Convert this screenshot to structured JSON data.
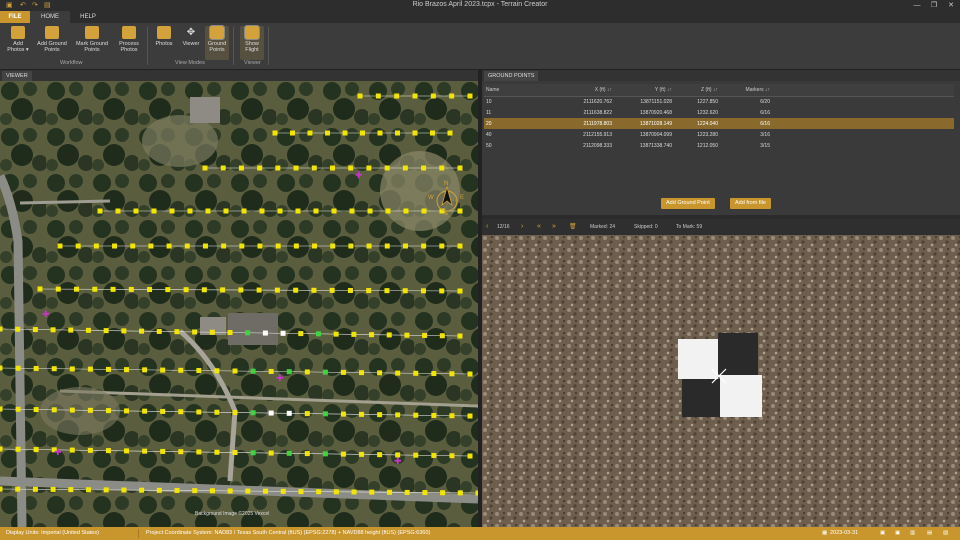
{
  "window": {
    "title": "Rio Brazos April 2023.tcpx  -  Terrain Creator",
    "controls": [
      "—",
      "❐",
      "✕"
    ]
  },
  "tabs": [
    "FILE",
    "HOME",
    "HELP"
  ],
  "ribbon": {
    "buttons": [
      {
        "label": "Add Photos ▾",
        "icon": "add-photos-icon"
      },
      {
        "label": "Add Ground Points",
        "icon": "add-ground-points-icon"
      },
      {
        "label": "Mark Ground Points",
        "icon": "mark-ground-points-icon"
      },
      {
        "label": "Process Photos",
        "icon": "process-photos-icon"
      },
      {
        "label": "Photos",
        "icon": "photos-icon"
      },
      {
        "label": "Viewer",
        "icon": "viewer-icon"
      },
      {
        "label": "Ground Points",
        "icon": "ground-points-icon"
      },
      {
        "label": "Show Flight",
        "icon": "show-flight-icon"
      }
    ],
    "groups": [
      "Workflow",
      "View Modes",
      "Viewer"
    ]
  },
  "viewer": {
    "tab": "VIEWER",
    "attribution": "Background Image ©2025 Vexcel",
    "compass": {
      "n": "N",
      "s": "S",
      "e": "E",
      "w": "W"
    }
  },
  "ground_points": {
    "tab": "GROUND POINTS",
    "columns": [
      "Name",
      "X (ft) ↓↑",
      "Y (ft) ↓↑",
      "Z (ft) ↓↑",
      "Markers ↓↑"
    ],
    "rows": [
      {
        "name": "10",
        "x": "2111620.762",
        "y": "13871151.028",
        "z": "1227.850",
        "markers": "6/20",
        "selected": false
      },
      {
        "name": "11",
        "x": "2111638.822",
        "y": "13870920.468",
        "z": "1232.620",
        "markers": "6/16",
        "selected": false
      },
      {
        "name": "20",
        "x": "2111978.803",
        "y": "13871028.149",
        "z": "1224.040",
        "markers": "6/16",
        "selected": true
      },
      {
        "name": "40",
        "x": "2112155.913",
        "y": "13870904.099",
        "z": "1223.280",
        "markers": "3/16",
        "selected": false
      },
      {
        "name": "50",
        "x": "2112098.333",
        "y": "13871338.740",
        "z": "1212.050",
        "markers": "3/15",
        "selected": false
      }
    ],
    "add_button": "Add Ground Point",
    "add_file_button": "Add from file"
  },
  "photo_nav": {
    "counter": "12/16",
    "marked": "Marked: 24",
    "skipped": "Skipped: 0",
    "to_mark": "To Mark: 59"
  },
  "status": {
    "units": "Display Units:  Imperial (United States)",
    "coord": "Project Coordinate System:  NAD83 / Texas South Central (ftUS) (EPSG:2278) + NAVD88 height (ftUS) (EPSG:6360)",
    "date": "2023-03-31"
  },
  "colors": {
    "accent": "#c8962c",
    "waypoint": "#f2e600",
    "marked": "#3fd43f",
    "gcp": "#cc33cc"
  }
}
